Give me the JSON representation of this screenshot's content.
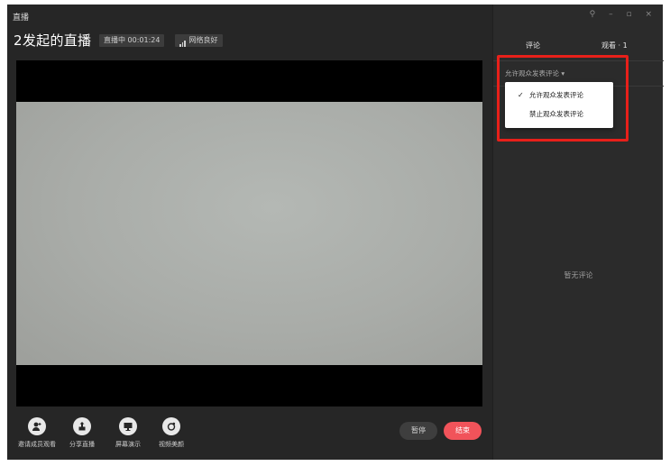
{
  "window": {
    "title": "直播"
  },
  "header": {
    "live_title": "2发起的直播",
    "status_badge": "直播中 00:01:24",
    "network_badge": "网络良好"
  },
  "toolbar": {
    "tools": [
      {
        "label": "邀请成员观看",
        "icon": "invite-user-icon"
      },
      {
        "label": "分享直播",
        "icon": "share-icon"
      },
      {
        "label": "屏幕演示",
        "icon": "screen-share-icon"
      },
      {
        "label": "视频美颜",
        "icon": "beauty-icon"
      }
    ],
    "pause_label": "暂停",
    "end_label": "结束"
  },
  "side": {
    "window_controls": "⚲ – ▫ ×",
    "tabs": {
      "comments": "评论",
      "viewers": "观看 · 1"
    },
    "comment_permission": "允许观众发表评论 ▾",
    "dropdown": {
      "options": [
        {
          "label": "允许观众发表评论",
          "checked": true
        },
        {
          "label": "禁止观众发表评论",
          "checked": false
        }
      ],
      "check_mark": "✓"
    },
    "empty_text": "暂无评论"
  },
  "colors": {
    "accent": "#3e8ef7",
    "end_button": "#f1535a",
    "highlight": "#e8201a"
  }
}
